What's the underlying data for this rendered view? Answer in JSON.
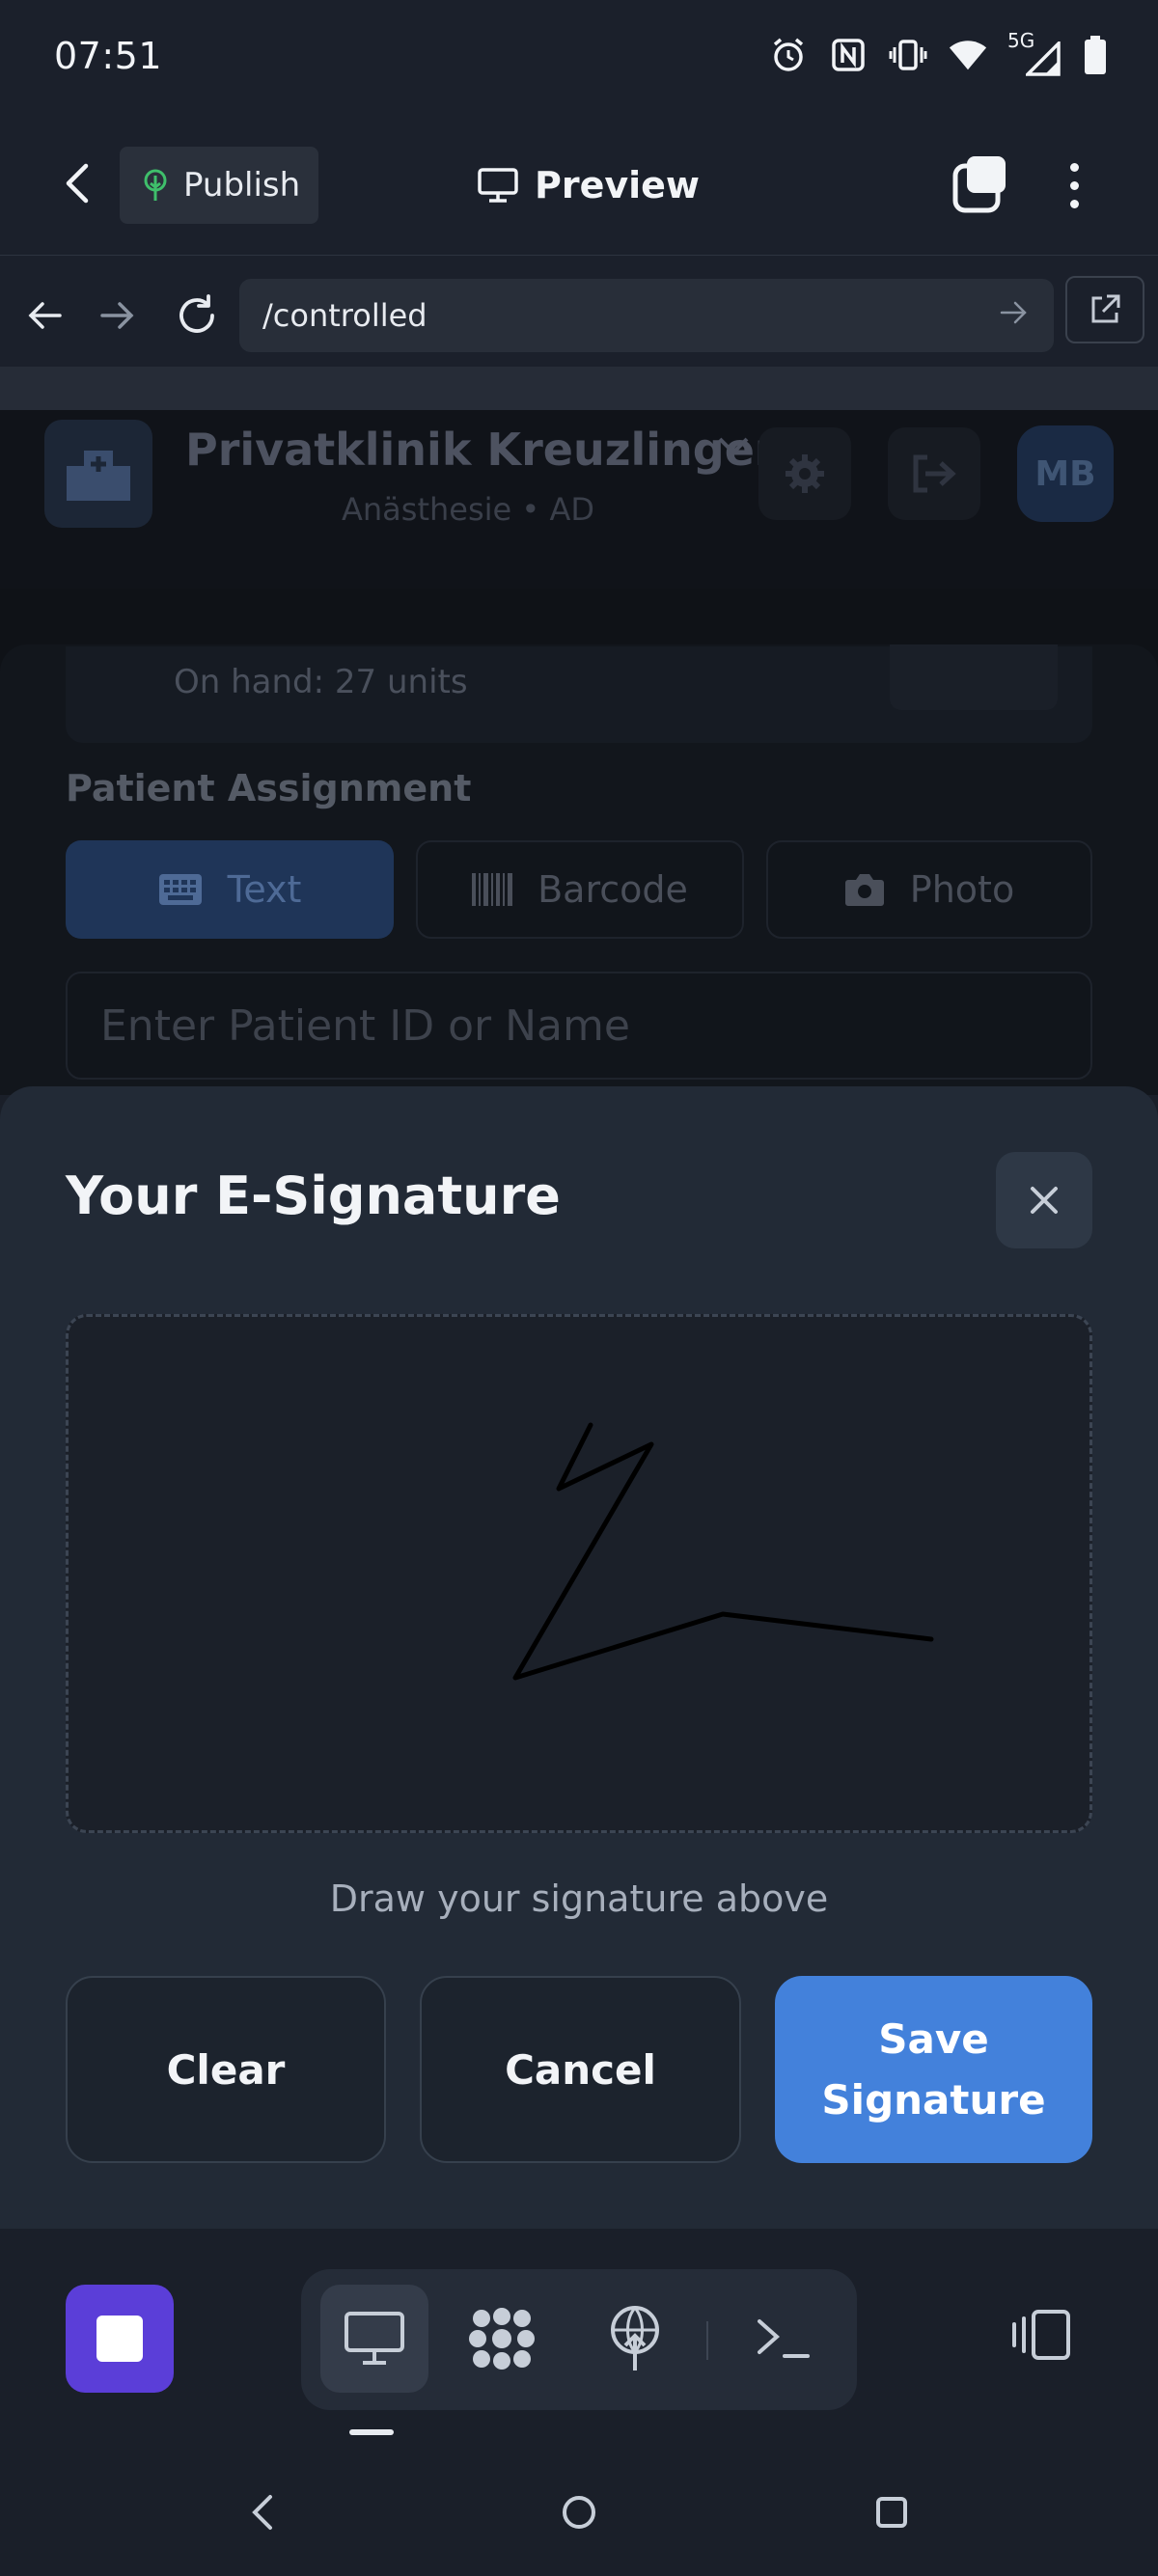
{
  "status_bar": {
    "time": "07:51",
    "network": "5G"
  },
  "app_bar": {
    "publish_label": "Publish",
    "preview_label": "Preview"
  },
  "url_bar": {
    "path": "/controlled"
  },
  "page": {
    "clinic_name": "Privatklinik Kreuzlingen",
    "clinic_subtitle": "Anästhesie • AD",
    "avatar_initials": "MB",
    "on_hand": "On hand: 27 units",
    "patient_assignment_label": "Patient Assignment",
    "modes": [
      {
        "label": "Text",
        "icon": "keyboard-icon",
        "active": true
      },
      {
        "label": "Barcode",
        "icon": "barcode-icon",
        "active": false
      },
      {
        "label": "Photo",
        "icon": "camera-icon",
        "active": false
      }
    ],
    "patient_input_placeholder": "Enter Patient ID or Name"
  },
  "modal": {
    "title": "Your E-Signature",
    "hint": "Draw your signature above",
    "clear_label": "Clear",
    "cancel_label": "Cancel",
    "save_label": "Save Signature"
  },
  "colors": {
    "accent": "#4381db",
    "stop_button": "#5b3ed8",
    "publish_icon": "#3fbf6b",
    "background": "#1a1f29",
    "modal": "#222a36"
  }
}
